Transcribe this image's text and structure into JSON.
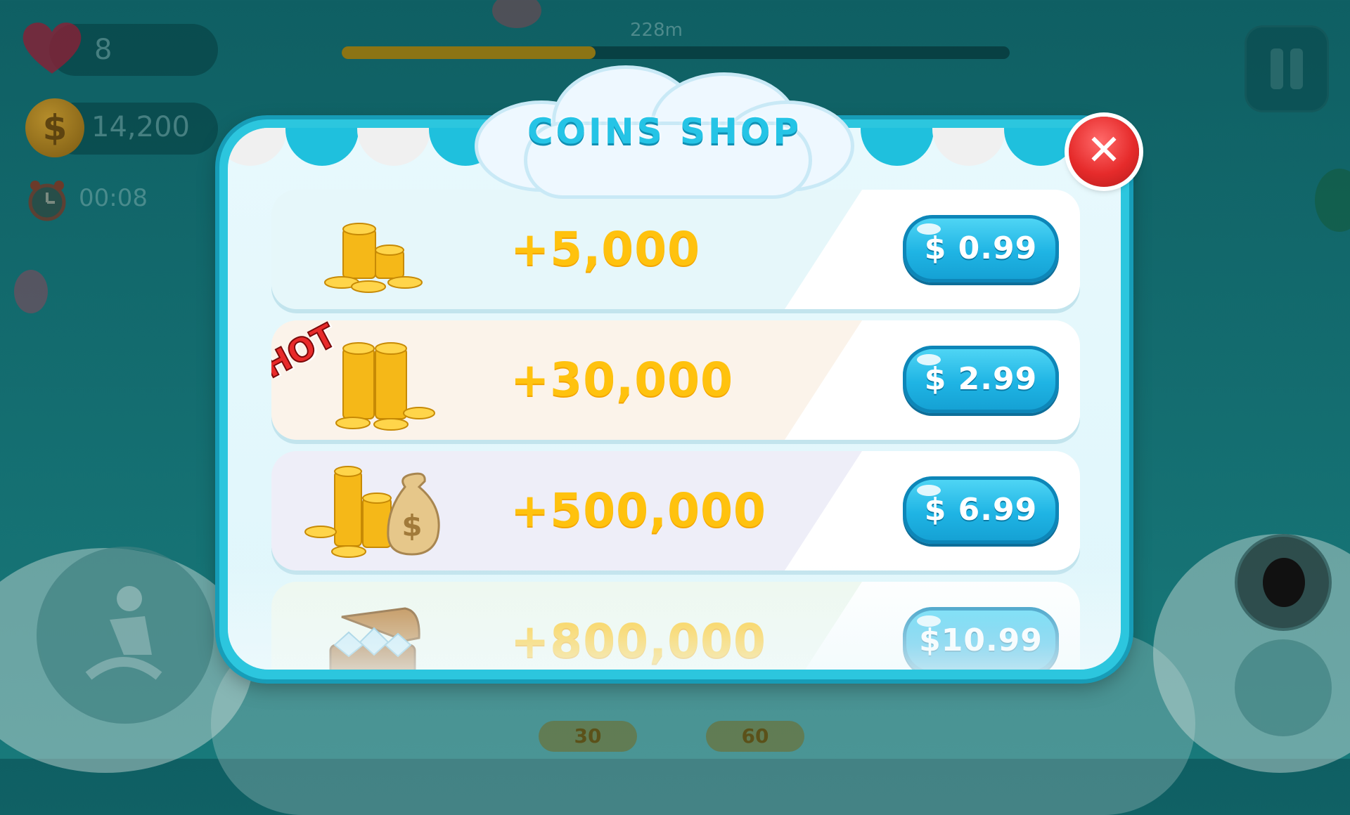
{
  "hud": {
    "lives": "8",
    "coins": "14,200",
    "timer": "00:08",
    "distance": "228m",
    "progress_fraction": 0.38
  },
  "modal": {
    "title": "COINS SHOP",
    "close_icon": "close-x-icon"
  },
  "shop": {
    "items": [
      {
        "amount": "+5,000",
        "price": "$ 0.99",
        "icon": "coin-stack-small-icon",
        "badge": ""
      },
      {
        "amount": "+30,000",
        "price": "$ 2.99",
        "icon": "coin-stack-medium-icon",
        "badge": "HOT"
      },
      {
        "amount": "+500,000",
        "price": "$ 6.99",
        "icon": "coin-stack-money-bag-icon",
        "badge": ""
      },
      {
        "amount": "+800,000",
        "price": "$10.99",
        "icon": "treasure-chest-diamonds-icon",
        "badge": ""
      }
    ]
  },
  "background_controls": {
    "powerup1_cost": "30",
    "powerup2_cost": "60"
  },
  "colors": {
    "accent_cyan": "#2cc6de",
    "amount_gold": "#ffc20e",
    "close_red": "#e62b2b"
  }
}
